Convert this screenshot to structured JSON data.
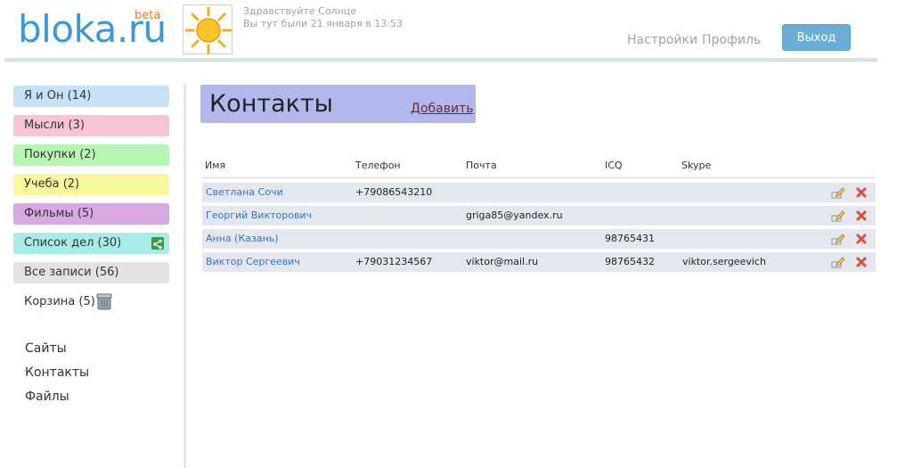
{
  "header": {
    "logo": "bloka.ru",
    "beta": "beta",
    "greeting": "Здравствуйте Солнце",
    "last_visit": "Вы тут были 21 января в 13:53",
    "settings": "Настройки",
    "profile": "Профиль",
    "logout": "Выход"
  },
  "sidebar": {
    "categories": [
      {
        "label": "Я и Он (14)",
        "color": "#c7e2f7"
      },
      {
        "label": "Мысли (3)",
        "color": "#f8c3d6"
      },
      {
        "label": "Покупки (2)",
        "color": "#b6f7b4"
      },
      {
        "label": "Учеба (2)",
        "color": "#f8f79b"
      },
      {
        "label": "Фильмы (5)",
        "color": "#d8a9e2"
      },
      {
        "label": "Список дел (30)",
        "color": "#a8ece7"
      },
      {
        "label": "Все записи (56)",
        "color": "#e2e2e2"
      }
    ],
    "trash": "Корзина (5)",
    "links": [
      "Сайты",
      "Контакты",
      "Файлы"
    ]
  },
  "main": {
    "title": "Контакты",
    "add": "Добавить",
    "columns": [
      "Имя",
      "Телефон",
      "Почта",
      "ICQ",
      "Skype"
    ],
    "rows": [
      {
        "name": "Светлана Сочи",
        "phone": "+79086543210",
        "email": "",
        "icq": "",
        "skype": ""
      },
      {
        "name": "Георгий Викторович",
        "phone": "",
        "email": "griga85@yandex.ru",
        "icq": "",
        "skype": ""
      },
      {
        "name": "Анна (Казань)",
        "phone": "",
        "email": "",
        "icq": "98765431",
        "skype": ""
      },
      {
        "name": "Виктор Сергеевич",
        "phone": "+79031234567",
        "email": "viktor@mail.ru",
        "icq": "98765432",
        "skype": "viktor.sergeevich"
      }
    ]
  },
  "icons": {
    "sun": "sun-icon",
    "share": "share-icon",
    "trash": "trash-icon",
    "edit": "edit-icon",
    "delete": "delete-icon"
  }
}
